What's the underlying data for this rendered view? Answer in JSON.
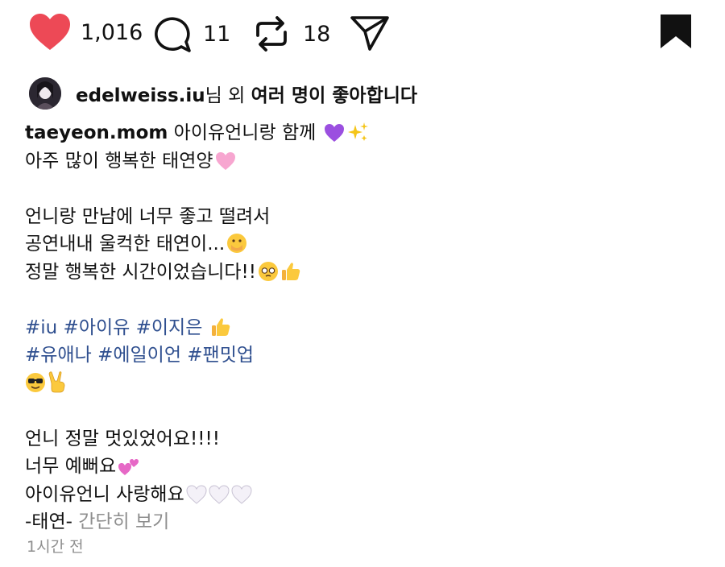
{
  "actions": {
    "like_count": "1,016",
    "comment_count": "11",
    "repost_count": "18"
  },
  "liked_by": {
    "username": "edelweiss.iu",
    "middle": "님 외 ",
    "rest": "여러 명이 좋아합니다"
  },
  "caption": {
    "author": "taeyeon.mom",
    "l1_text": " 아이유언니랑 함께",
    "l2_text": "아주 많이 행복한 태연양",
    "l3_text": "언니랑 만남에 너무 좋고 떨려서",
    "l4_text": "공연내내 울컥한 태연이...",
    "l5_text": "정말 행복한 시간이었습니다!!",
    "tags1": "#iu #아이유 #이지은",
    "tags2": "#유애나 #에일이언 #팬밋업",
    "l9_text": "언니 정말 멋있었어요!!!!",
    "l10_text": "너무 예뻐요",
    "l11_text": "아이유언니 사랑해요",
    "l12_text": "-태연-",
    "more": "간단히 보기"
  },
  "timestamp": "1시간 전",
  "icons": [
    "heart-icon",
    "comment-icon",
    "repost-icon",
    "share-icon",
    "bookmark-icon"
  ],
  "colors": {
    "like": "#ed4956",
    "hashtag": "#2f4f8f",
    "muted": "#8e8e8e"
  }
}
